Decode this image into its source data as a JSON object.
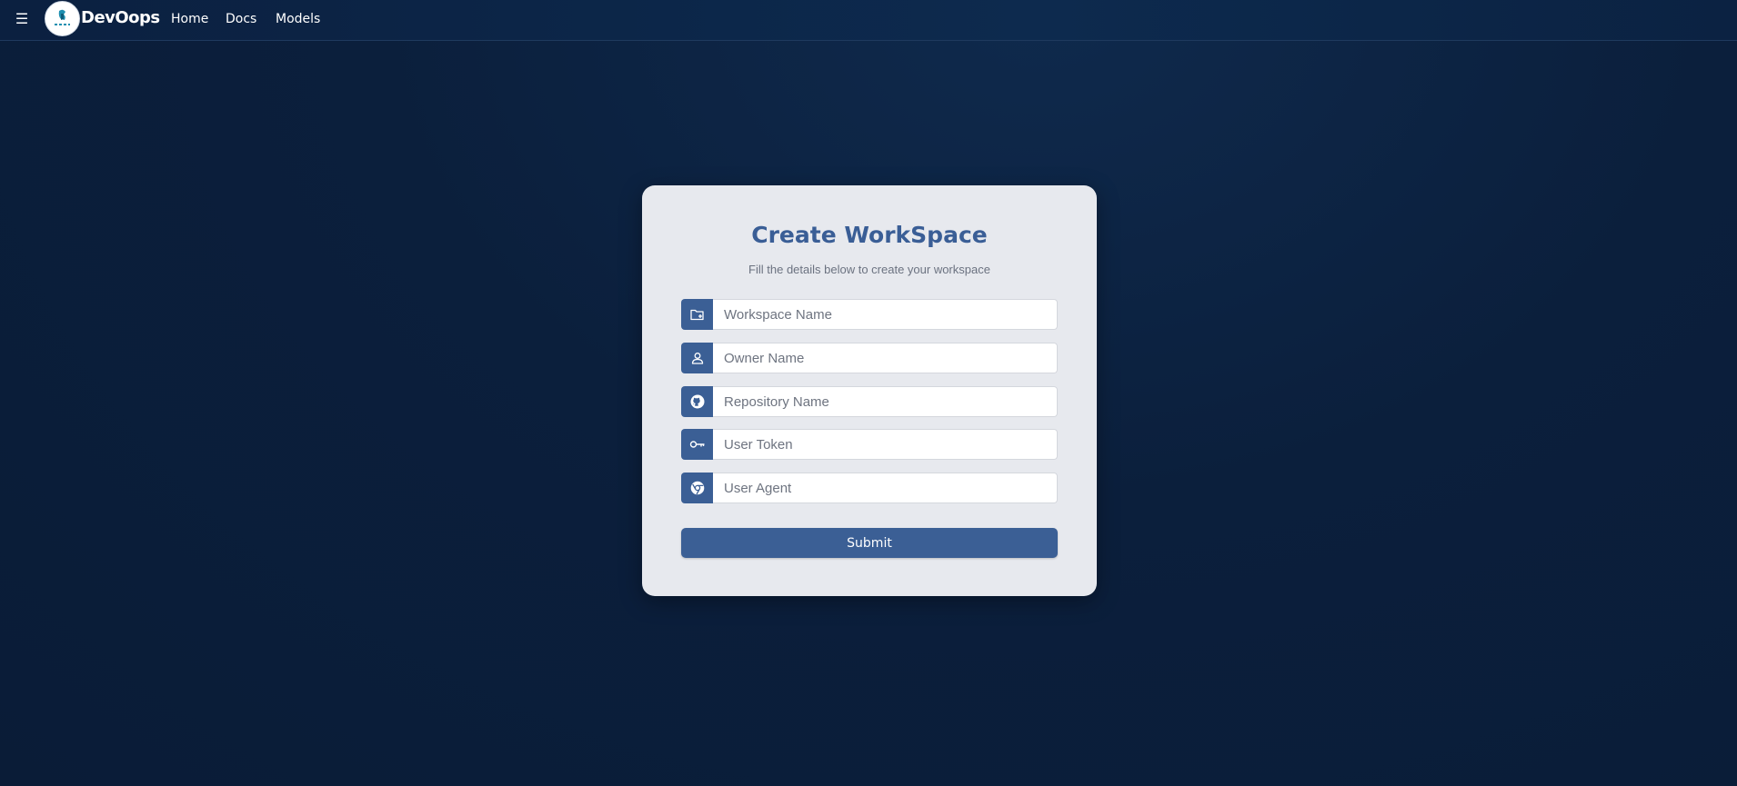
{
  "navbar": {
    "menu_icon": "hamburger-menu-icon",
    "menu_glyph": "☰",
    "logo_icon": "devoops-logo",
    "brand": "DevOops",
    "links": [
      {
        "label": "Home"
      },
      {
        "label": "Docs"
      },
      {
        "label": "Models"
      }
    ]
  },
  "form": {
    "title": "Create WorkSpace",
    "subtitle": "Fill the details below to create your workspace",
    "fields": [
      {
        "icon": "folder-plus-icon",
        "placeholder": "Workspace Name",
        "value": ""
      },
      {
        "icon": "user-icon",
        "placeholder": "Owner Name",
        "value": ""
      },
      {
        "icon": "github-icon",
        "placeholder": "Repository Name",
        "value": ""
      },
      {
        "icon": "key-icon",
        "placeholder": "User Token",
        "value": ""
      },
      {
        "icon": "chrome-icon",
        "placeholder": "User Agent",
        "value": ""
      }
    ],
    "submit_label": "Submit"
  },
  "colors": {
    "accent": "#3b5f95",
    "title": "#3a5e96",
    "card_bg": "#e7e9ee",
    "page_bg": "#0b1f3c"
  }
}
